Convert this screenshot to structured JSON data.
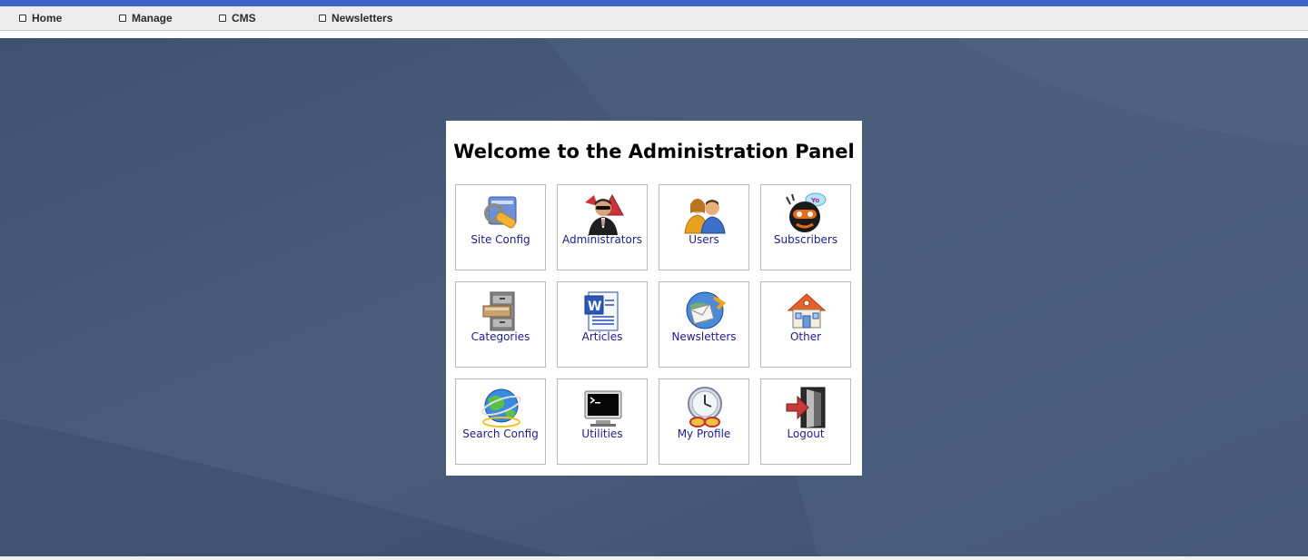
{
  "menu": {
    "items": [
      {
        "label": "Home"
      },
      {
        "label": "Manage"
      },
      {
        "label": "CMS"
      },
      {
        "label": "Newsletters"
      }
    ]
  },
  "panel": {
    "title": "Welcome to the Administration Panel",
    "tiles": [
      {
        "label": "Site Config",
        "icon": "wrench-icon"
      },
      {
        "label": "Administrators",
        "icon": "admin-agent-icon"
      },
      {
        "label": "Users",
        "icon": "users-icon"
      },
      {
        "label": "Subscribers",
        "icon": "subscriber-face-icon"
      },
      {
        "label": "Categories",
        "icon": "filing-cabinet-icon"
      },
      {
        "label": "Articles",
        "icon": "document-icon"
      },
      {
        "label": "Newsletters",
        "icon": "mail-globe-icon"
      },
      {
        "label": "Other",
        "icon": "house-icon"
      },
      {
        "label": "Search Config",
        "icon": "globe-icon"
      },
      {
        "label": "Utilities",
        "icon": "terminal-icon"
      },
      {
        "label": "My Profile",
        "icon": "clock-glasses-icon"
      },
      {
        "label": "Logout",
        "icon": "exit-door-icon"
      }
    ]
  },
  "colors": {
    "accent_strip": "#3c64c8",
    "desktop_background": "#475a76",
    "tile_label": "#1c1c8c"
  }
}
